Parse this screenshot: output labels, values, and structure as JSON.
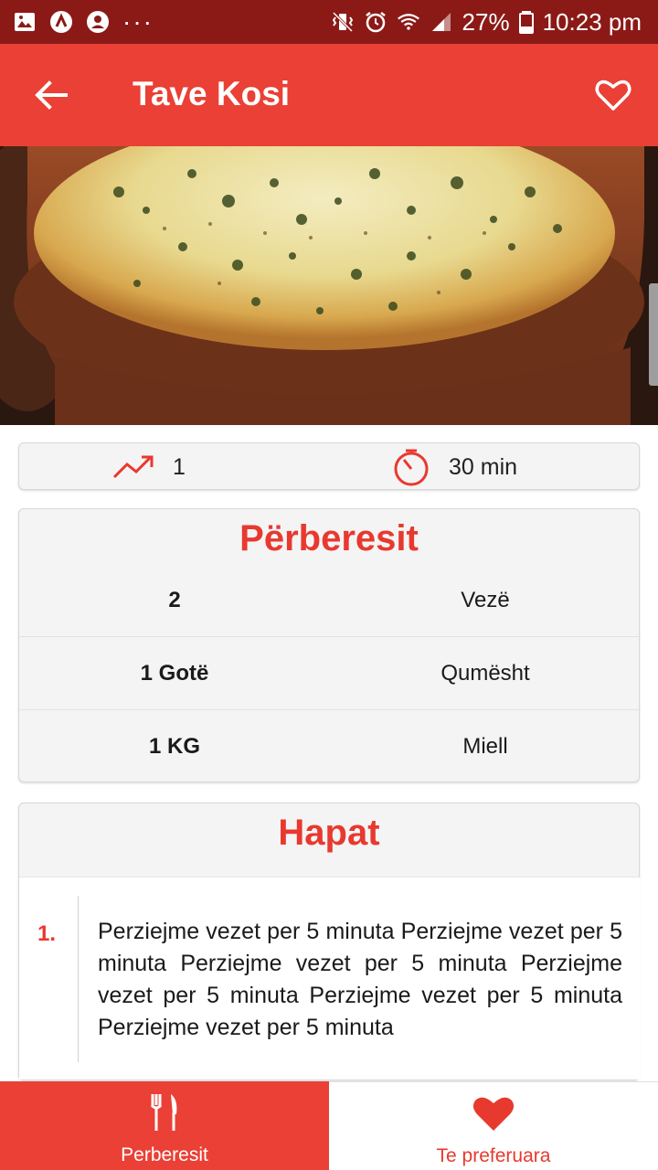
{
  "status_bar": {
    "battery": "27%",
    "time": "10:23 pm",
    "dots": "···"
  },
  "app_bar": {
    "title": "Tave Kosi",
    "back_icon": "arrow-left-icon",
    "favorite_icon": "heart-outline-icon"
  },
  "colors": {
    "primary": "#ea4035",
    "status_bar": "#8b1a17",
    "accent_text": "#e8392f"
  },
  "stats": {
    "difficulty_icon": "trending-up-icon",
    "difficulty": "1",
    "time_icon": "timer-icon",
    "time": "30 min"
  },
  "ingredients": {
    "title": "Përberesit",
    "items": [
      {
        "quantity": "2",
        "name": "Vezë"
      },
      {
        "quantity": "1 Gotë",
        "name": "Qumësht"
      },
      {
        "quantity": "1 KG",
        "name": "Miell"
      }
    ]
  },
  "steps": {
    "title": "Hapat",
    "items": [
      {
        "number": "1.",
        "text": " Perziejme vezet per 5 minuta Perziejme vezet per 5 minuta Perziejme vezet per 5 minuta Perziejme vezet per 5 minuta Perziejme vezet per 5 minuta Perziejme vezet per 5 minuta"
      }
    ]
  },
  "bottom_nav": {
    "tabs": [
      {
        "label": "Perberesit",
        "icon": "fork-knife-icon",
        "active": true
      },
      {
        "label": "Te preferuara",
        "icon": "heart-icon",
        "active": false
      }
    ]
  }
}
